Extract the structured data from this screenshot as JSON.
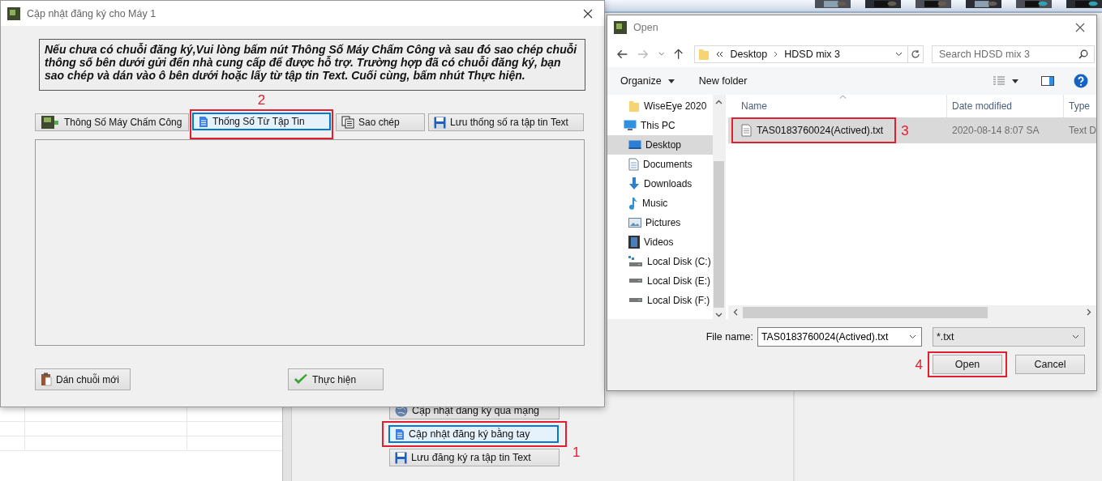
{
  "main_dialog": {
    "title": "Cập nhật đăng ký cho Máy 1",
    "instructions": "Nếu chưa có chuỗi đăng ký,Vui lòng bấm nút Thông Số Máy Chấm Công và sau đó sao chép chuỗi thông số bên dưới gửi đến nhà cung cấp để được hỗ trợ. Trường hợp đã có chuỗi đăng ký, bạn sao chép và dán vào ô bên dưới hoặc lấy từ tập tin Text. Cuối cùng, bấm nhút Thực hiện.",
    "buttons": [
      {
        "label": "Thông Số Máy Chấm Công",
        "selected": false
      },
      {
        "label": "Thống Số Từ Tập Tin",
        "selected": true,
        "callout": "2"
      },
      {
        "label": "Sao chép",
        "selected": false
      },
      {
        "label": "Lưu thống số ra tập tin Text",
        "selected": false
      }
    ],
    "bottom_buttons": [
      {
        "label": "Dán chuỗi mới"
      },
      {
        "label": "Thực hiện"
      }
    ]
  },
  "open_dialog": {
    "title": "Open",
    "path": [
      "Desktop",
      "HDSD mix 3"
    ],
    "search": {
      "placeholder": "Search HDSD mix 3"
    },
    "toolbar": [
      "Organize",
      "New folder"
    ],
    "nav_items": [
      {
        "label": "WiseEye 2020",
        "selected": false
      },
      {
        "label": "This PC",
        "selected": false
      },
      {
        "label": "Desktop",
        "selected": true
      },
      {
        "label": "Documents",
        "selected": false
      },
      {
        "label": "Downloads",
        "selected": false
      },
      {
        "label": "Music",
        "selected": false
      },
      {
        "label": "Pictures",
        "selected": false
      },
      {
        "label": "Videos",
        "selected": false
      },
      {
        "label": "Local Disk (C:)",
        "selected": false
      },
      {
        "label": "Local Disk (E:)",
        "selected": false
      },
      {
        "label": "Local Disk (F:)",
        "selected": false
      }
    ],
    "columns": [
      "Name",
      "Date modified",
      "Type"
    ],
    "files": [
      {
        "name": "TAS0183760024(Actived).txt",
        "date": "2020-08-14 8:07 SA",
        "type": "Text D",
        "selected": true,
        "callout": "3"
      }
    ],
    "file_name_label": "File name:",
    "file_name": "TAS0183760024(Actived).txt",
    "filter": "*.txt",
    "buttons": [
      {
        "label": "Open",
        "callout": "4"
      },
      {
        "label": "Cancel"
      }
    ]
  },
  "background_panel": {
    "buttons": [
      {
        "label": "Cập nhật đăng ký qua mạng",
        "selected": false
      },
      {
        "label": "Cập nhật đăng ký bằng tay",
        "selected": true,
        "callout": "1"
      },
      {
        "label": "Lưu đăng ký ra tập tin Text",
        "selected": false
      }
    ]
  }
}
